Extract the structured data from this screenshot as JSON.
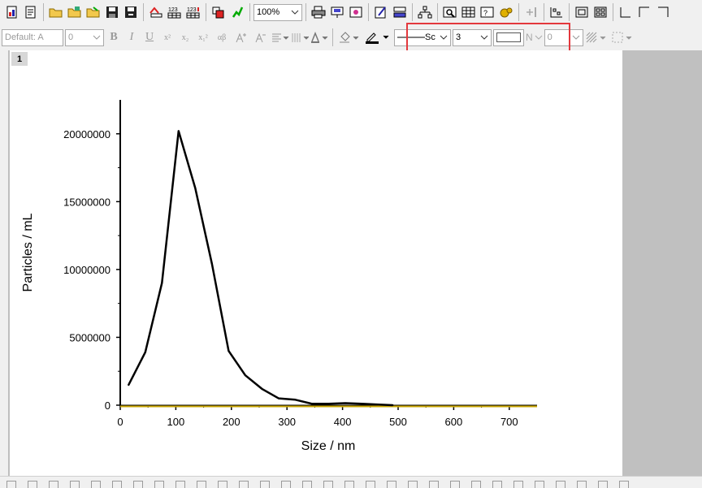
{
  "toolbar": {
    "zoom_value": "100%",
    "font_name": "Default: A",
    "font_size": "0",
    "bold_label": "B",
    "italic_label": "I",
    "underline_label": "U",
    "superscript_label": "x²",
    "subscript_label": "x₂",
    "supsub_label": "x₁²",
    "greek_label": "αβ",
    "line_style_value": "Sc",
    "line_width_value": "3",
    "n_label": "N",
    "pattern_value": "0"
  },
  "layer": {
    "number": "1"
  },
  "colors": {
    "curve": "#000000",
    "highlight": "#e3383d",
    "x_axis": "#c8a400"
  },
  "icons": [
    "new-graph-icon",
    "new-layout-icon",
    "open-icon",
    "open-template-icon",
    "save-project-icon",
    "save-template-icon",
    "print-icon",
    "refresh-icon",
    "zoom-icon",
    "line-color-icon",
    "fill-color-icon"
  ],
  "chart_data": {
    "type": "line",
    "title": "",
    "xlabel": "Size / nm",
    "ylabel": "Particles / mL",
    "xlim": [
      0,
      750
    ],
    "ylim": [
      0,
      22500000
    ],
    "xticks": [
      0,
      100,
      200,
      300,
      400,
      500,
      600,
      700
    ],
    "yticks": [
      0,
      5000000,
      10000000,
      15000000,
      20000000
    ],
    "xtick_labels": [
      "0",
      "100",
      "200",
      "300",
      "400",
      "500",
      "600",
      "700"
    ],
    "ytick_labels": [
      "0",
      "5000000",
      "10000000",
      "15000000",
      "20000000"
    ],
    "grid": false,
    "x": [
      15,
      45,
      75,
      105,
      135,
      165,
      195,
      225,
      255,
      285,
      315,
      345,
      375,
      405,
      435,
      465,
      490
    ],
    "y": [
      1500000,
      3900000,
      9000000,
      20200000,
      16000000,
      10400000,
      4000000,
      2200000,
      1200000,
      500000,
      400000,
      100000,
      100000,
      150000,
      100000,
      50000,
      0
    ]
  }
}
